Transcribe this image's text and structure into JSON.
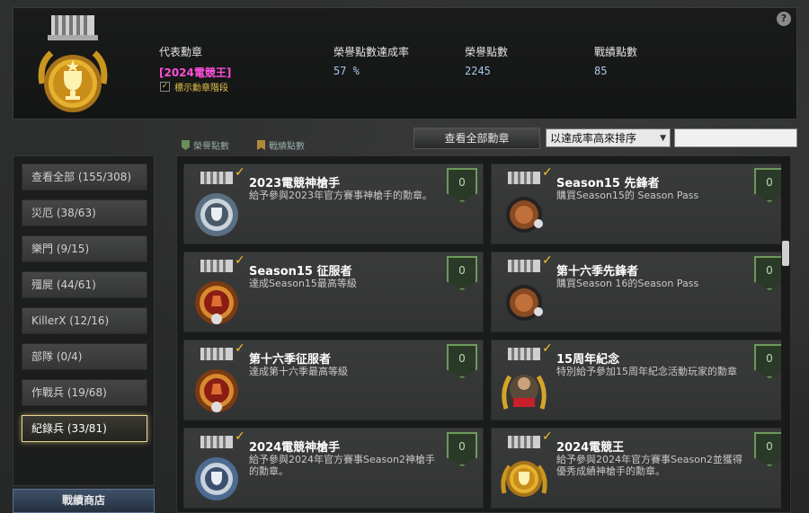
{
  "header": {
    "help": "?",
    "stats": [
      {
        "label": "代表勳章",
        "value": "[2024電競王]"
      },
      {
        "label": "榮譽點數達成率",
        "value": "57 %"
      },
      {
        "label": "榮譽點數",
        "value": "2245"
      },
      {
        "label": "戰績點數",
        "value": "85"
      }
    ],
    "show_medal_level": {
      "label": "標示勳章階段",
      "checked": true
    }
  },
  "legend": {
    "honor": "榮譽點數",
    "record": "戰績點數"
  },
  "toolbar": {
    "view_all": "查看全部勳章",
    "sort_value": "以達成率高來排序",
    "search_value": ""
  },
  "sidebar": {
    "categories": [
      {
        "label": "查看全部 (155/308)",
        "active": false
      },
      {
        "label": "災厄 (38/63)",
        "active": false
      },
      {
        "label": "樂門 (9/15)",
        "active": false
      },
      {
        "label": "殭屍 (44/61)",
        "active": false
      },
      {
        "label": "KillerX (12/16)",
        "active": false
      },
      {
        "label": "部隊 (0/4)",
        "active": false
      },
      {
        "label": "作戰兵 (19/68)",
        "active": false
      },
      {
        "label": "紀錄兵 (33/81)",
        "active": true
      }
    ],
    "shop": "戰績商店"
  },
  "cards": [
    {
      "title": "2023電競神槍手",
      "desc": "給予參與2023年官方賽事神槍手的勳章。",
      "points": "0",
      "medal": "silver"
    },
    {
      "title": "Season15 先鋒者",
      "desc": "購買Season15的 Season Pass",
      "points": "0",
      "medal": "bronze"
    },
    {
      "title": "Season15 征服者",
      "desc": "達成Season15最高等級",
      "points": "0",
      "medal": "bronze-e"
    },
    {
      "title": "第十六季先鋒者",
      "desc": "購買Season 16的Season Pass",
      "points": "0",
      "medal": "bronze"
    },
    {
      "title": "第十六季征服者",
      "desc": "達成第十六季最高等級",
      "points": "0",
      "medal": "bronze-e"
    },
    {
      "title": "15周年紀念",
      "desc": "特別給予參加15周年紀念活動玩家的勳章",
      "points": "0",
      "medal": "anniv"
    },
    {
      "title": "2024電競神槍手",
      "desc": "給予參與2024年官方賽事Season2神槍手的勳章。",
      "points": "0",
      "medal": "silver"
    },
    {
      "title": "2024電競王",
      "desc": "給予參與2024年官方賽事Season2並獲得優秀成績神槍手的勳章。",
      "points": "0",
      "medal": "gold"
    }
  ],
  "colors": {
    "accent_gold": "#f2c230",
    "rep_medal": "#ff4fd8",
    "points_green": "#6d9a5a"
  }
}
